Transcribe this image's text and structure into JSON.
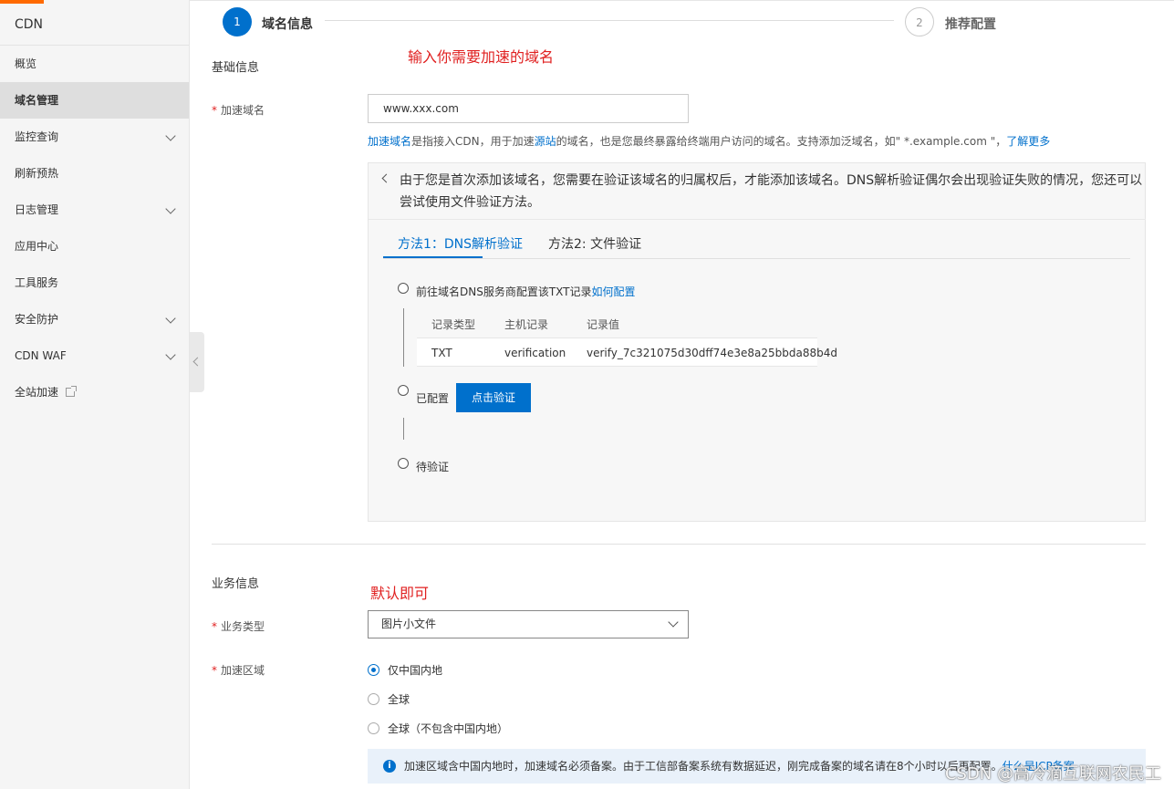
{
  "sidebar": {
    "title": "CDN",
    "items": [
      {
        "label": "概览"
      },
      {
        "label": "域名管理"
      },
      {
        "label": "监控查询"
      },
      {
        "label": "刷新预热"
      },
      {
        "label": "日志管理"
      },
      {
        "label": "应用中心"
      },
      {
        "label": "工具服务"
      },
      {
        "label": "安全防护"
      },
      {
        "label": "CDN WAF"
      },
      {
        "label": "全站加速"
      }
    ]
  },
  "steps": [
    {
      "num": "1",
      "label": "域名信息"
    },
    {
      "num": "2",
      "label": "推荐配置"
    }
  ],
  "annotations": {
    "domain_hint": "输入你需要加速的域名",
    "default_hint": "默认即可"
  },
  "basic": {
    "section_title": "基础信息",
    "required_mark": "*",
    "domain_label": "加速域名",
    "domain_value": "www.xxx.com",
    "help": {
      "link1": "加速域名",
      "text1": "是指接入CDN，用于加速",
      "link2": "源站",
      "text2": "的域名，也是您最终暴露给终端用户访问的域名。支持添加泛域名，如\" *.example.com \"，",
      "link3": "了解更多"
    }
  },
  "verify": {
    "message": "由于您是首次添加该域名，您需要在验证该域名的归属权后，才能添加该域名。DNS解析验证偶尔会出现验证失败的情况，您还可以尝试使用文件验证方法。",
    "tabs": [
      "方法1：DNS解析验证",
      "方法2: 文件验证"
    ],
    "step1_text": "前往域名DNS服务商配置该TXT记录",
    "step1_link": "如何配置",
    "table_headers": [
      "记录类型",
      "主机记录",
      "记录值"
    ],
    "table_row": [
      "TXT",
      "verification",
      "verify_7c321075d30dff74e3e8a25bbda88b4d"
    ],
    "step2_text": "已配置",
    "verify_button": "点击验证",
    "step3_text": "待验证"
  },
  "business": {
    "section_title": "业务信息",
    "type_label": "业务类型",
    "type_value": "图片小文件",
    "region_label": "加速区域",
    "region_options": [
      "仅中国内地",
      "全球",
      "全球（不包含中国内地）"
    ],
    "region_selected": 0,
    "notice_text": "加速区域含中国内地时，加速域名必须备案。由于工信部备案系统有数据延迟，刚完成备案的域名请在8个小时以后再配置。",
    "notice_link": "什么是ICP备案"
  },
  "watermark": "CSDN @高冷滴互联网农民工",
  "colors": {
    "accent": "#0070cc",
    "brand": "#ff6a00",
    "annotation": "#e02020"
  }
}
